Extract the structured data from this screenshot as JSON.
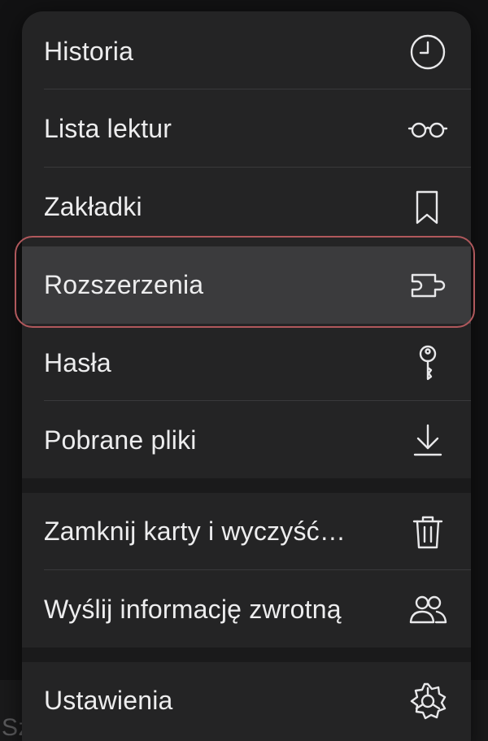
{
  "background": {
    "partial_text": "Sz"
  },
  "menu": {
    "items": [
      {
        "label": "Historia",
        "icon": "clock-icon"
      },
      {
        "label": "Lista lektur",
        "icon": "glasses-icon"
      },
      {
        "label": "Zakładki",
        "icon": "bookmark-icon"
      },
      {
        "label": "Rozszerzenia",
        "icon": "extension-icon",
        "highlighted": true
      },
      {
        "label": "Hasła",
        "icon": "key-icon"
      },
      {
        "label": "Pobrane pliki",
        "icon": "download-icon"
      },
      {
        "label": "Zamknij karty i wyczyść…",
        "icon": "trash-icon"
      },
      {
        "label": "Wyślij informację zwrotną",
        "icon": "people-icon"
      },
      {
        "label": "Ustawienia",
        "icon": "gear-icon"
      }
    ]
  },
  "colors": {
    "menu_background": "#242425",
    "highlight_background": "#3b3b3d",
    "highlight_border": "#b0585c",
    "text": "#ededee"
  }
}
